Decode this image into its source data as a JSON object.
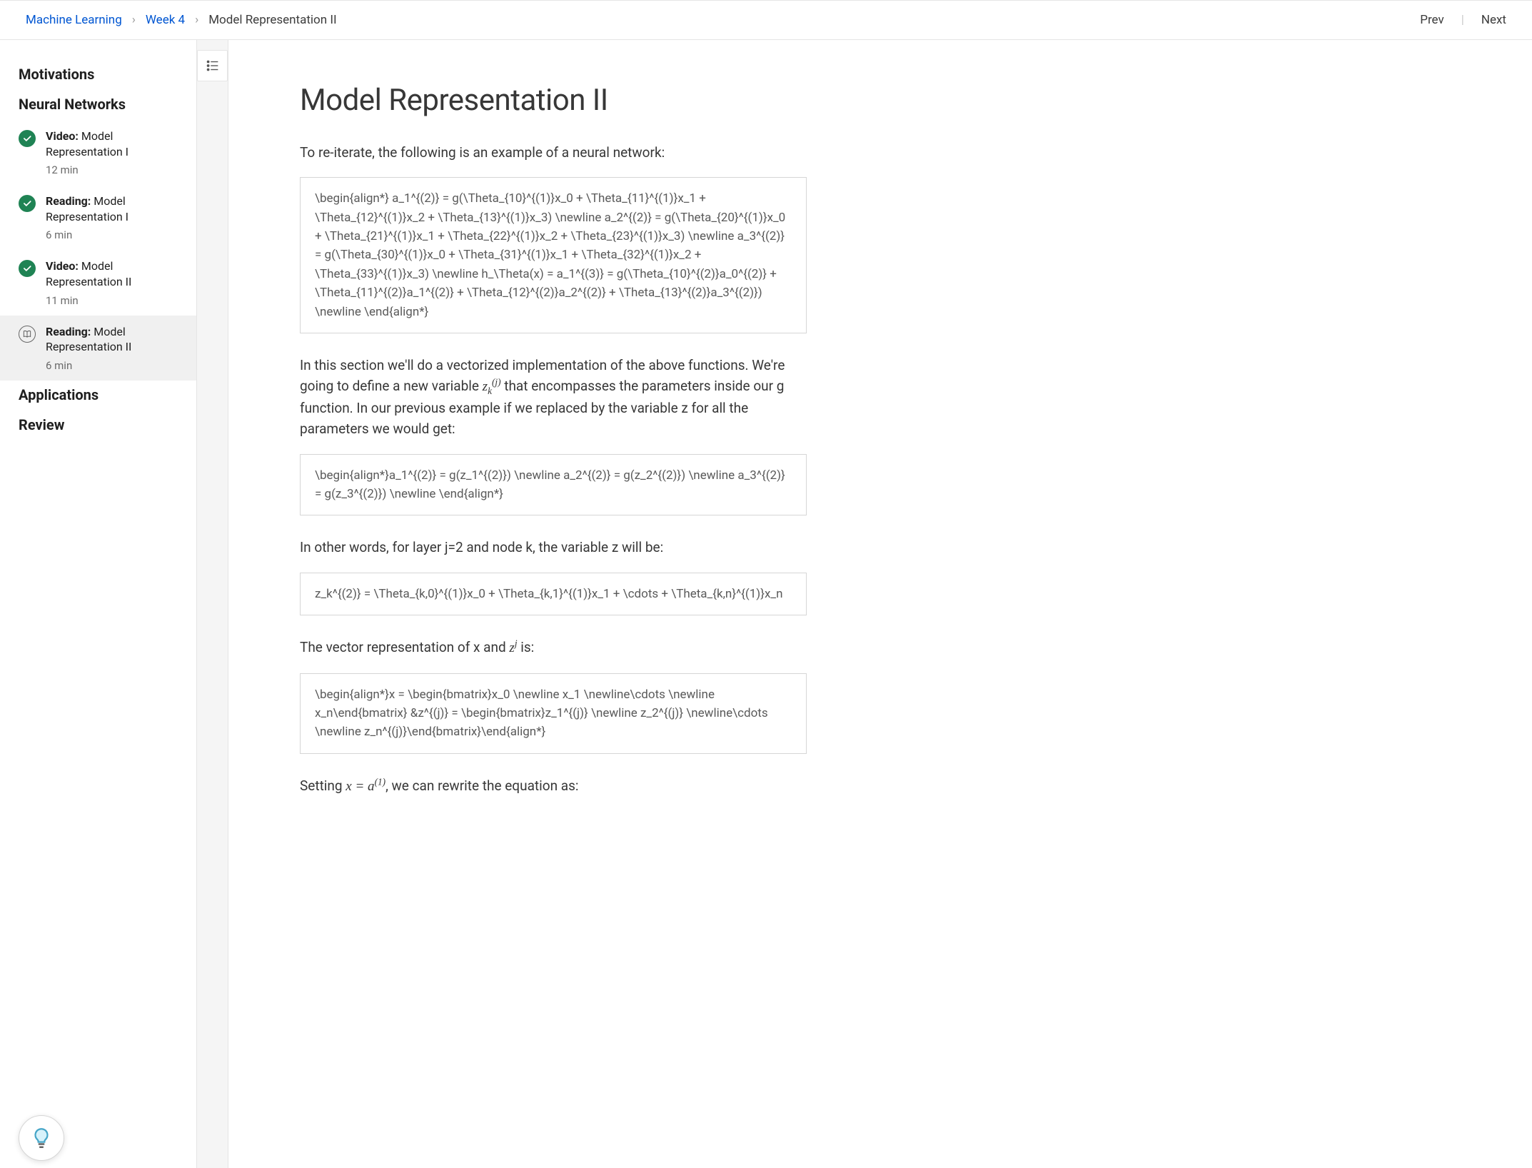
{
  "breadcrumbs": {
    "course": "Machine Learning",
    "week": "Week 4",
    "page": "Model Representation II"
  },
  "topnav": {
    "prev": "Prev",
    "next": "Next"
  },
  "sidebar": {
    "sections": [
      {
        "title": "Motivations"
      },
      {
        "title": "Neural Networks",
        "items": [
          {
            "kind": "Video:",
            "name": "Model Representation I",
            "duration": "12 min",
            "status": "done"
          },
          {
            "kind": "Reading:",
            "name": "Model Representation I",
            "duration": "6 min",
            "status": "done"
          },
          {
            "kind": "Video:",
            "name": "Model Representation II",
            "duration": "11 min",
            "status": "done"
          },
          {
            "kind": "Reading:",
            "name": "Model Representation II",
            "duration": "6 min",
            "status": "current"
          }
        ]
      },
      {
        "title": "Applications"
      },
      {
        "title": "Review"
      }
    ]
  },
  "article": {
    "title": "Model Representation II",
    "p1": "To re-iterate, the following is an example of a neural network:",
    "math1": "\\begin{align*} a_1^{(2)} = g(\\Theta_{10}^{(1)}x_0 + \\Theta_{11}^{(1)}x_1 + \\Theta_{12}^{(1)}x_2 + \\Theta_{13}^{(1)}x_3) \\newline a_2^{(2)} = g(\\Theta_{20}^{(1)}x_0 + \\Theta_{21}^{(1)}x_1 + \\Theta_{22}^{(1)}x_2 + \\Theta_{23}^{(1)}x_3) \\newline a_3^{(2)} = g(\\Theta_{30}^{(1)}x_0 + \\Theta_{31}^{(1)}x_1 + \\Theta_{32}^{(1)}x_2 + \\Theta_{33}^{(1)}x_3) \\newline h_\\Theta(x) = a_1^{(3)} = g(\\Theta_{10}^{(2)}a_0^{(2)} + \\Theta_{11}^{(2)}a_1^{(2)} + \\Theta_{12}^{(2)}a_2^{(2)} + \\Theta_{13}^{(2)}a_3^{(2)}) \\newline \\end{align*}",
    "p2a": "In this section we'll do a vectorized implementation of the above functions. We're going to define a new variable ",
    "p2var": "z_k^{(j)}",
    "p2b": " that encompasses the parameters inside our g function. In our previous example if we replaced by the variable z for all the parameters we would get:",
    "math2": "\\begin{align*}a_1^{(2)} = g(z_1^{(2)}) \\newline a_2^{(2)} = g(z_2^{(2)}) \\newline a_3^{(2)} = g(z_3^{(2)}) \\newline \\end{align*}",
    "p3": "In other words, for layer j=2 and node k, the variable z will be:",
    "math3": "z_k^{(2)} = \\Theta_{k,0}^{(1)}x_0 + \\Theta_{k,1}^{(1)}x_1 + \\cdots + \\Theta_{k,n}^{(1)}x_n",
    "p4a": "The vector representation of x and ",
    "p4var": "z^j",
    "p4b": " is:",
    "math4": "\\begin{align*}x = \\begin{bmatrix}x_0 \\newline x_1 \\newline\\cdots \\newline x_n\\end{bmatrix} &z^{(j)} = \\begin{bmatrix}z_1^{(j)} \\newline z_2^{(j)} \\newline\\cdots \\newline z_n^{(j)}\\end{bmatrix}\\end{align*}",
    "p5a": "Setting ",
    "p5var": "x = a^{(1)}",
    "p5b": ", we can rewrite the equation as:"
  }
}
